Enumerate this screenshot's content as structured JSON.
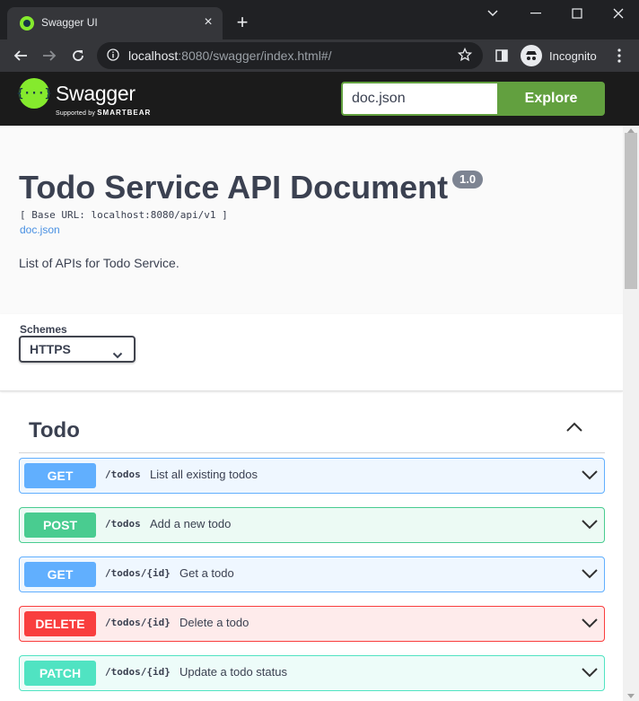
{
  "browser": {
    "tab_title": "Swagger UI",
    "url_host": "localhost",
    "url_rest": ":8080/swagger/index.html#/",
    "incognito_label": "Incognito"
  },
  "topbar": {
    "logo_text": "Swagger",
    "logo_sub_prefix": "Supported by",
    "logo_sub_brand": "SMARTBEAR",
    "explore_input": "doc.json",
    "explore_button": "Explore"
  },
  "info": {
    "title": "Todo Service API Document",
    "version": "1.0",
    "base_url": "[ Base URL: localhost:8080/api/v1 ]",
    "doc_link": "doc.json",
    "description": "List of APIs for Todo Service."
  },
  "schemes": {
    "label": "Schemes",
    "selected": "HTTPS"
  },
  "tag": {
    "name": "Todo"
  },
  "operations": [
    {
      "method": "GET",
      "path": "/todos",
      "summary": "List all existing todos"
    },
    {
      "method": "POST",
      "path": "/todos",
      "summary": "Add a new todo"
    },
    {
      "method": "GET",
      "path": "/todos/{id}",
      "summary": "Get a todo"
    },
    {
      "method": "DELETE",
      "path": "/todos/{id}",
      "summary": "Delete a todo"
    },
    {
      "method": "PATCH",
      "path": "/todos/{id}",
      "summary": "Update a todo status"
    }
  ],
  "colors": {
    "get": "#61affe",
    "post": "#49cc90",
    "delete": "#f93e3e",
    "patch": "#50e3c2",
    "explore": "#62a03f"
  }
}
